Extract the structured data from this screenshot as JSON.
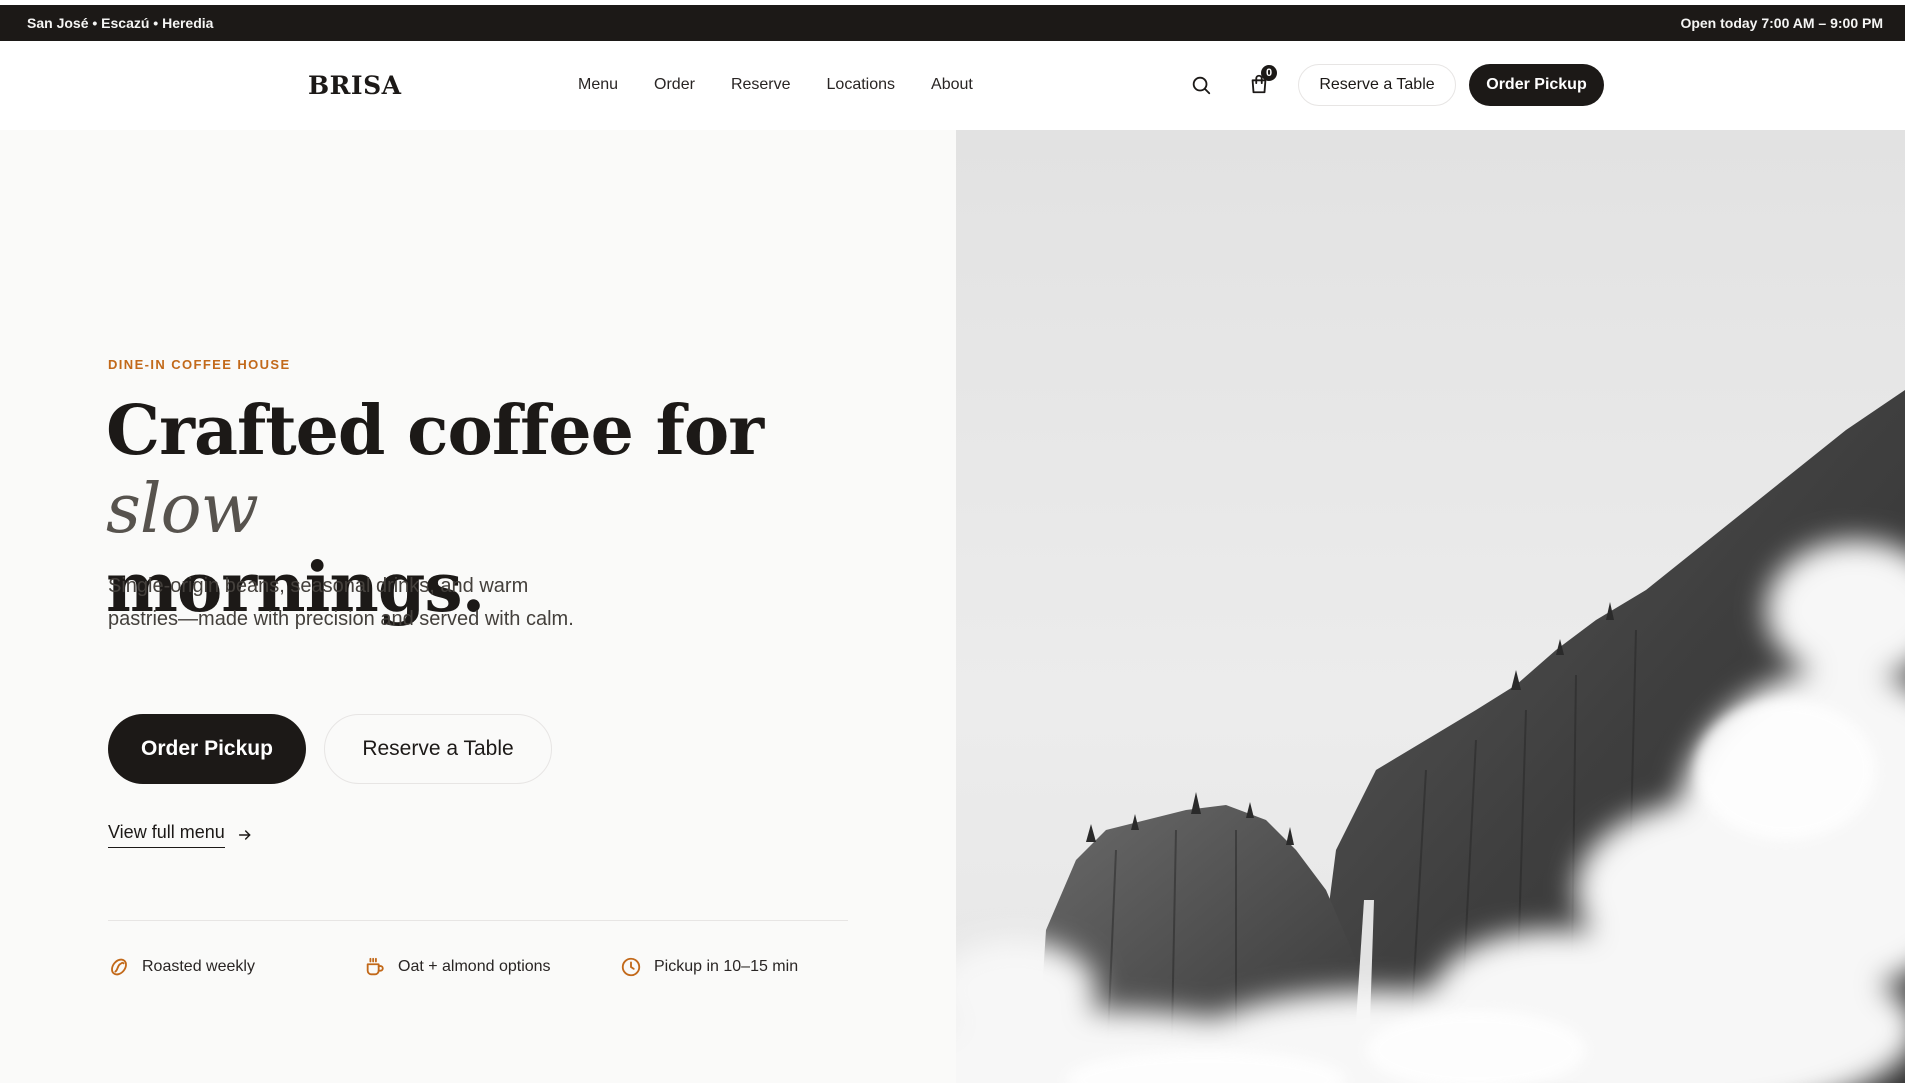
{
  "topbar": {
    "locations": "San José • Escazú • Heredia",
    "hours": "Open today 7:00 AM – 9:00 PM"
  },
  "nav": {
    "brand": "BRISA",
    "links": [
      "Menu",
      "Order",
      "Reserve",
      "Locations",
      "About"
    ],
    "search_icon": "search-icon",
    "cart_icon": "shopping-bag-icon",
    "cart_count": "0",
    "reserve_label": "Reserve a Table",
    "order_label": "Order Pickup"
  },
  "hero": {
    "eyebrow": "DINE-IN COFFEE HOUSE",
    "headline_main": "Crafted coffee for ",
    "headline_accent": "slow",
    "headline_end": "mornings.",
    "lede": "Single-origin beans, seasonal drinks, and warm pastries—made with precision and served with calm.",
    "primary_cta": "Order Pickup",
    "secondary_cta": "Reserve a Table",
    "menu_link": "View full menu",
    "menu_link_icon": "arrow-right-icon",
    "image": "black-and-white misty cliffs with waterfall"
  },
  "features": [
    {
      "icon": "coffee-bean-icon",
      "label": "Roasted weekly"
    },
    {
      "icon": "coffee-cup-icon",
      "label": "Oat + almond options"
    },
    {
      "icon": "clock-icon",
      "label": "Pickup in 10–15 min"
    }
  ],
  "colors": {
    "dark": "#1c1917",
    "accent": "#c2691a",
    "hero_bg": "#fafaf9"
  }
}
